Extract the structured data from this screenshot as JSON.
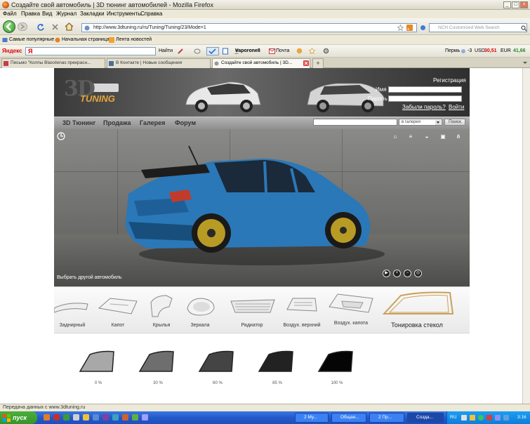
{
  "window": {
    "title": "Создайте свой автомобиль | 3D тюнинг автомобилей - Mozilla Firefox"
  },
  "menu": [
    "Файл",
    "Правка",
    "Вид",
    "Журнал",
    "Закладки",
    "Инструменты",
    "Справка"
  ],
  "nav": {
    "url": "http://www.3dtuning.ru/ru/Tuning/Tuning/23/Mode=1",
    "search_placeholder": "NCH Customized Web Search"
  },
  "bookmarks": [
    "Самые популярные",
    "Начальная страница",
    "Лента новостей"
  ],
  "yandex_bar": {
    "brand": "Яндекс",
    "go_label": "Найти",
    "user": "Vaporone8",
    "mail_label": "Почта",
    "region": "Пермь",
    "temp": "-3",
    "usd_label": "USD",
    "usd": "30,51",
    "eur_label": "EUR",
    "eur": "41,66"
  },
  "tabs": [
    {
      "label": "Письмо \"Колпы Blaxxlenas прекрасн...",
      "active": false
    },
    {
      "label": "В Контакте | Новые сообщения",
      "active": false
    },
    {
      "label": "Создайте свой автомобиль | 3D...",
      "active": true
    }
  ],
  "site": {
    "logo_3d": "3D",
    "logo_tuning": "TUNING",
    "register_link": "Регистрация",
    "login_label": "Имя",
    "password_label": "Пароль",
    "forgot_link": "Забыли пароль?",
    "login_link": "Войти",
    "nav_items": [
      "3D Тюнинг",
      "Продажа",
      "Галерея",
      "Форум"
    ],
    "search_scope": "в галерея",
    "search_button": "Поиск",
    "choose_car_link": "Выбрать другой автомобиль",
    "parts": [
      {
        "label": "Заднирный",
        "active": false
      },
      {
        "label": "Капот",
        "active": false
      },
      {
        "label": "Крылья",
        "active": false
      },
      {
        "label": "Зеркала",
        "active": false
      },
      {
        "label": "Радиатор",
        "active": false
      },
      {
        "label": "Воздух. верхний",
        "active": false
      },
      {
        "label": "Воздух. капота",
        "active": false
      },
      {
        "label": "Тонировка стекол",
        "active": true
      }
    ],
    "tints": [
      {
        "label": "0 %",
        "color": "#a8a8a8"
      },
      {
        "label": "30 %",
        "color": "#6e6e6e"
      },
      {
        "label": "60 %",
        "color": "#444444"
      },
      {
        "label": "85 %",
        "color": "#222222"
      },
      {
        "label": "100 %",
        "color": "#050505"
      }
    ]
  },
  "status": {
    "text": "Передача данных с www.3dtuning.ru"
  },
  "taskbar": {
    "start_label": "пуск",
    "buttons": [
      {
        "label": "2 Му...",
        "active": false
      },
      {
        "label": "Общая...",
        "active": false
      },
      {
        "label": "2 Пр...",
        "active": false
      },
      {
        "label": "Созда...",
        "active": true
      }
    ],
    "language": "RU",
    "clock": "3:16"
  }
}
